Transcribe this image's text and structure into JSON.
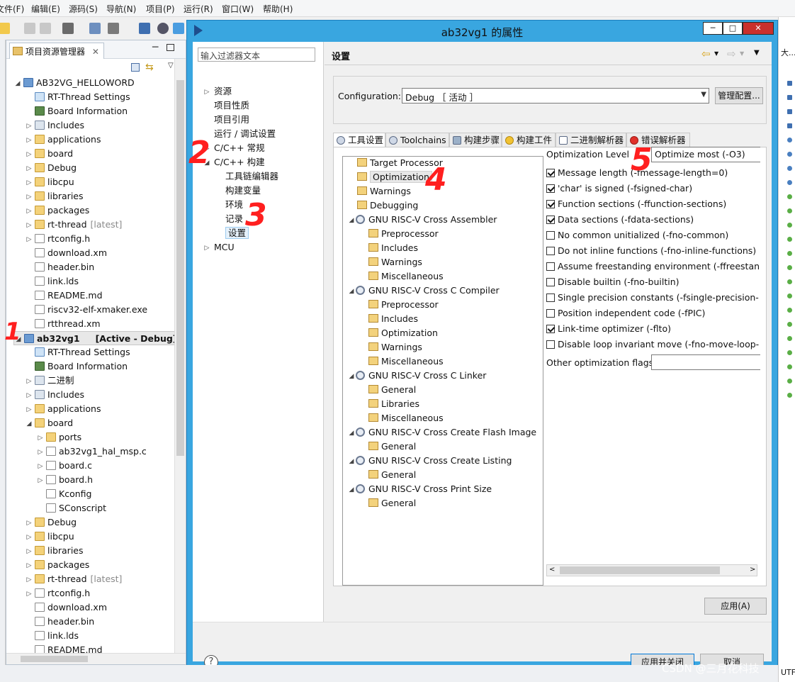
{
  "menubar": {
    "items": [
      "文件(F)",
      "编辑(E)",
      "源码(S)",
      "导航(N)",
      "项目(P)",
      "运行(R)",
      "窗口(W)",
      "帮助(H)"
    ]
  },
  "explorer": {
    "tab_label": "项目资源管理器",
    "items": [
      {
        "label": "AB32VG_HELLOWORD",
        "icon": "project-icon",
        "level": 0,
        "expand": "open"
      },
      {
        "label": "RT-Thread Settings",
        "icon": "rt-icon",
        "level": 1,
        "expand": "none"
      },
      {
        "label": "Board Information",
        "icon": "board-icon",
        "level": 1,
        "expand": "none"
      },
      {
        "label": "Includes",
        "icon": "includes-icon",
        "level": 1,
        "expand": "closed"
      },
      {
        "label": "applications",
        "icon": "folder-icon",
        "level": 1,
        "expand": "closed"
      },
      {
        "label": "board",
        "icon": "folder-icon",
        "level": 1,
        "expand": "closed"
      },
      {
        "label": "Debug",
        "icon": "folder-icon",
        "level": 1,
        "expand": "closed"
      },
      {
        "label": "libcpu",
        "icon": "folder-icon",
        "level": 1,
        "expand": "closed"
      },
      {
        "label": "libraries",
        "icon": "folder-icon",
        "level": 1,
        "expand": "closed"
      },
      {
        "label": "packages",
        "icon": "folder-icon",
        "level": 1,
        "expand": "closed"
      },
      {
        "label": "rt-thread",
        "suffix": "[latest]",
        "icon": "folder-icon",
        "level": 1,
        "expand": "closed"
      },
      {
        "label": "rtconfig.h",
        "icon": "file-icon",
        "level": 1,
        "expand": "closed"
      },
      {
        "label": "download.xm",
        "icon": "file-icon",
        "level": 1,
        "expand": "none"
      },
      {
        "label": "header.bin",
        "icon": "file-icon",
        "level": 1,
        "expand": "none"
      },
      {
        "label": "link.lds",
        "icon": "file-icon",
        "level": 1,
        "expand": "none"
      },
      {
        "label": "README.md",
        "icon": "file-icon",
        "level": 1,
        "expand": "none"
      },
      {
        "label": "riscv32-elf-xmaker.exe",
        "icon": "file-icon",
        "level": 1,
        "expand": "none"
      },
      {
        "label": "rtthread.xm",
        "icon": "file-icon",
        "level": 1,
        "expand": "none"
      },
      {
        "label": "ab32vg1",
        "suffix": "[Active - Debug]",
        "icon": "project-icon",
        "level": 0,
        "expand": "open",
        "bold": true
      },
      {
        "label": "RT-Thread Settings",
        "icon": "rt-icon",
        "level": 1,
        "expand": "none"
      },
      {
        "label": "Board Information",
        "icon": "board-icon",
        "level": 1,
        "expand": "none"
      },
      {
        "label": "二进制",
        "icon": "binary-icon",
        "level": 1,
        "expand": "closed"
      },
      {
        "label": "Includes",
        "icon": "includes-icon",
        "level": 1,
        "expand": "closed"
      },
      {
        "label": "applications",
        "icon": "folder-icon",
        "level": 1,
        "expand": "closed"
      },
      {
        "label": "board",
        "icon": "folder-icon",
        "level": 1,
        "expand": "open"
      },
      {
        "label": "ports",
        "icon": "folder-icon",
        "level": 2,
        "expand": "closed"
      },
      {
        "label": "ab32vg1_hal_msp.c",
        "icon": "file-icon",
        "level": 2,
        "expand": "closed"
      },
      {
        "label": "board.c",
        "icon": "file-icon",
        "level": 2,
        "expand": "closed"
      },
      {
        "label": "board.h",
        "icon": "file-icon",
        "level": 2,
        "expand": "closed"
      },
      {
        "label": "Kconfig",
        "icon": "file-icon",
        "level": 2,
        "expand": "none"
      },
      {
        "label": "SConscript",
        "icon": "file-icon",
        "level": 2,
        "expand": "none"
      },
      {
        "label": "Debug",
        "icon": "folder-icon",
        "level": 1,
        "expand": "closed"
      },
      {
        "label": "libcpu",
        "icon": "folder-icon",
        "level": 1,
        "expand": "closed"
      },
      {
        "label": "libraries",
        "icon": "folder-icon",
        "level": 1,
        "expand": "closed"
      },
      {
        "label": "packages",
        "icon": "folder-icon",
        "level": 1,
        "expand": "closed"
      },
      {
        "label": "rt-thread",
        "suffix": "[latest]",
        "icon": "folder-icon",
        "level": 1,
        "expand": "closed"
      },
      {
        "label": "rtconfig.h",
        "icon": "file-icon",
        "level": 1,
        "expand": "closed"
      },
      {
        "label": "download.xm",
        "icon": "file-icon",
        "level": 1,
        "expand": "none"
      },
      {
        "label": "header.bin",
        "icon": "file-icon",
        "level": 1,
        "expand": "none"
      },
      {
        "label": "link.lds",
        "icon": "file-icon",
        "level": 1,
        "expand": "none"
      },
      {
        "label": "README.md",
        "icon": "file-icon",
        "level": 1,
        "expand": "none"
      }
    ]
  },
  "dialog": {
    "title": "ab32vg1 的属性",
    "filter_placeholder": "输入过滤器文本",
    "nav": [
      {
        "label": "资源",
        "level": 0,
        "expand": "closed"
      },
      {
        "label": "项目性质",
        "level": 0,
        "expand": "none"
      },
      {
        "label": "项目引用",
        "level": 0,
        "expand": "none"
      },
      {
        "label": "运行 / 调试设置",
        "level": 0,
        "expand": "none"
      },
      {
        "label": "C/C++ 常规",
        "level": 0,
        "expand": "closed"
      },
      {
        "label": "C/C++ 构建",
        "level": 0,
        "expand": "open"
      },
      {
        "label": "工具链编辑器",
        "level": 1,
        "expand": "none"
      },
      {
        "label": "构建变量",
        "level": 1,
        "expand": "none"
      },
      {
        "label": "环境",
        "level": 1,
        "expand": "none"
      },
      {
        "label": "记录",
        "level": 1,
        "expand": "none"
      },
      {
        "label": "设置",
        "level": 1,
        "expand": "none",
        "selected": true
      },
      {
        "label": "MCU",
        "level": 0,
        "expand": "closed"
      }
    ],
    "section_title": "设置",
    "configuration_label": "Configuration:",
    "configuration_value": "Debug ［ 活动 ］",
    "manage_button": "管理配置...",
    "tabs": [
      "工具设置",
      "Toolchains",
      "构建步骤",
      "构建工件",
      "二进制解析器",
      "错误解析器"
    ],
    "tool_tree": [
      {
        "label": "Target Processor",
        "level": 1,
        "type": "page"
      },
      {
        "label": "Optimization",
        "level": 1,
        "type": "page",
        "selected": true
      },
      {
        "label": "Warnings",
        "level": 1,
        "type": "page"
      },
      {
        "label": "Debugging",
        "level": 1,
        "type": "page"
      },
      {
        "label": "GNU RISC-V Cross Assembler",
        "level": 0,
        "type": "tool"
      },
      {
        "label": "Preprocessor",
        "level": 2,
        "type": "page"
      },
      {
        "label": "Includes",
        "level": 2,
        "type": "page"
      },
      {
        "label": "Warnings",
        "level": 2,
        "type": "page"
      },
      {
        "label": "Miscellaneous",
        "level": 2,
        "type": "page"
      },
      {
        "label": "GNU RISC-V Cross C Compiler",
        "level": 0,
        "type": "tool"
      },
      {
        "label": "Preprocessor",
        "level": 2,
        "type": "page"
      },
      {
        "label": "Includes",
        "level": 2,
        "type": "page"
      },
      {
        "label": "Optimization",
        "level": 2,
        "type": "page"
      },
      {
        "label": "Warnings",
        "level": 2,
        "type": "page"
      },
      {
        "label": "Miscellaneous",
        "level": 2,
        "type": "page"
      },
      {
        "label": "GNU RISC-V Cross C Linker",
        "level": 0,
        "type": "tool"
      },
      {
        "label": "General",
        "level": 2,
        "type": "page"
      },
      {
        "label": "Libraries",
        "level": 2,
        "type": "page"
      },
      {
        "label": "Miscellaneous",
        "level": 2,
        "type": "page"
      },
      {
        "label": "GNU RISC-V Cross Create Flash Image",
        "level": 0,
        "type": "tool"
      },
      {
        "label": "General",
        "level": 2,
        "type": "page"
      },
      {
        "label": "GNU RISC-V Cross Create Listing",
        "level": 0,
        "type": "tool"
      },
      {
        "label": "General",
        "level": 2,
        "type": "page"
      },
      {
        "label": "GNU RISC-V Cross Print Size",
        "level": 0,
        "type": "tool"
      },
      {
        "label": "General",
        "level": 2,
        "type": "page"
      }
    ],
    "optimization_level_label": "Optimization Level",
    "optimization_level_value": "Optimize most (-O3)",
    "options": [
      {
        "label": "Message length (-fmessage-length=0)",
        "checked": true
      },
      {
        "label": "'char' is signed (-fsigned-char)",
        "checked": true
      },
      {
        "label": "Function sections (-ffunction-sections)",
        "checked": true
      },
      {
        "label": "Data sections (-fdata-sections)",
        "checked": true
      },
      {
        "label": "No common unitialized (-fno-common)",
        "checked": false
      },
      {
        "label": "Do not inline functions (-fno-inline-functions)",
        "checked": false
      },
      {
        "label": "Assume freestanding environment (-ffreestanding)",
        "checked": false
      },
      {
        "label": "Disable builtin (-fno-builtin)",
        "checked": false
      },
      {
        "label": "Single precision constants (-fsingle-precision-constant)",
        "checked": false
      },
      {
        "label": "Position independent code (-fPIC)",
        "checked": false
      },
      {
        "label": "Link-time optimizer (-flto)",
        "checked": true
      },
      {
        "label": "Disable loop invariant move (-fno-move-loop-invariants)",
        "checked": false
      }
    ],
    "other_flags_label": "Other optimization flags",
    "other_flags_value": "",
    "apply_button": "应用(A)",
    "apply_close_button": "应用并关闭",
    "cancel_button": "取消"
  },
  "annotations": [
    "1",
    "2",
    "3",
    "4",
    "5"
  ],
  "watermark": "CSDN @三月花科技",
  "right_panel": {
    "label": "大...",
    "status": "UTF"
  },
  "colors": {
    "title_bar": "#39a6e0",
    "selection": "#e5f1fb",
    "annotation": "#ff1f1f"
  }
}
